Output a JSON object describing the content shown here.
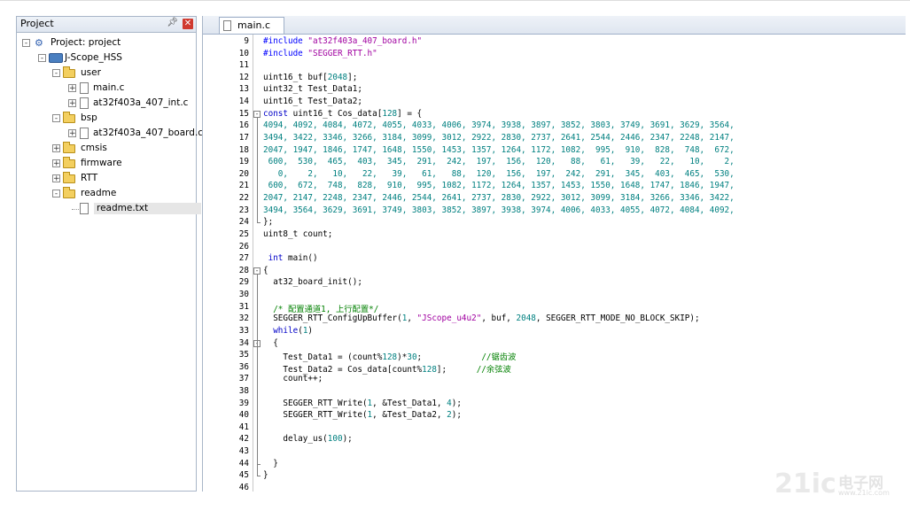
{
  "project_panel": {
    "title": "Project",
    "tree": [
      {
        "label": "Project: project",
        "icon": "project-root-icon"
      },
      {
        "label": "J-Scope_HSS",
        "icon": "target-icon"
      },
      {
        "label": "user",
        "icon": "folder-icon"
      },
      {
        "label": "main.c",
        "icon": "file-icon"
      },
      {
        "label": "at32f403a_407_int.c",
        "icon": "file-icon"
      },
      {
        "label": "bsp",
        "icon": "folder-icon"
      },
      {
        "label": "at32f403a_407_board.c",
        "icon": "file-icon"
      },
      {
        "label": "cmsis",
        "icon": "folder-icon"
      },
      {
        "label": "firmware",
        "icon": "folder-icon"
      },
      {
        "label": "RTT",
        "icon": "folder-icon"
      },
      {
        "label": "readme",
        "icon": "folder-icon"
      },
      {
        "label": "readme.txt",
        "icon": "file-icon"
      }
    ]
  },
  "editor": {
    "tab_label": "main.c",
    "lines": [
      {
        "n": "9",
        "fold": "",
        "parts": [
          [
            "pre",
            "#include "
          ],
          [
            "str",
            "\"at32f403a_407_board.h\""
          ]
        ]
      },
      {
        "n": "10",
        "fold": "",
        "parts": [
          [
            "pre",
            "#include "
          ],
          [
            "str",
            "\"SEGGER_RTT.h\""
          ]
        ]
      },
      {
        "n": "11",
        "fold": "",
        "parts": []
      },
      {
        "n": "12",
        "fold": "",
        "parts": [
          [
            "txt",
            "uint16_t buf["
          ],
          [
            "num",
            "2048"
          ],
          [
            "txt",
            "];"
          ]
        ]
      },
      {
        "n": "13",
        "fold": "",
        "parts": [
          [
            "txt",
            "uint32_t Test_Data1;"
          ]
        ]
      },
      {
        "n": "14",
        "fold": "",
        "parts": [
          [
            "txt",
            "uint16_t Test_Data2;"
          ]
        ]
      },
      {
        "n": "15",
        "fold": "open",
        "parts": [
          [
            "kw",
            "const"
          ],
          [
            "txt",
            " uint16_t Cos_data["
          ],
          [
            "num",
            "128"
          ],
          [
            "txt",
            "] = {"
          ]
        ]
      },
      {
        "n": "16",
        "fold": "",
        "parts": [
          [
            "num",
            "4094, 4092, 4084, 4072, 4055, 4033, 4006, 3974, 3938, 3897, 3852, 3803, 3749, 3691, 3629, 3564,"
          ]
        ]
      },
      {
        "n": "17",
        "fold": "",
        "parts": [
          [
            "num",
            "3494, 3422, 3346, 3266, 3184, 3099, 3012, 2922, 2830, 2737, 2641, 2544, 2446, 2347, 2248, 2147,"
          ]
        ]
      },
      {
        "n": "18",
        "fold": "",
        "parts": [
          [
            "num",
            "2047, 1947, 1846, 1747, 1648, 1550, 1453, 1357, 1264, 1172, 1082,  995,  910,  828,  748,  672,"
          ]
        ]
      },
      {
        "n": "19",
        "fold": "",
        "parts": [
          [
            "num",
            " 600,  530,  465,  403,  345,  291,  242,  197,  156,  120,   88,   61,   39,   22,   10,    2,"
          ]
        ]
      },
      {
        "n": "20",
        "fold": "",
        "parts": [
          [
            "num",
            "   0,    2,   10,   22,   39,   61,   88,  120,  156,  197,  242,  291,  345,  403,  465,  530,"
          ]
        ]
      },
      {
        "n": "21",
        "fold": "",
        "parts": [
          [
            "num",
            " 600,  672,  748,  828,  910,  995, 1082, 1172, 1264, 1357, 1453, 1550, 1648, 1747, 1846, 1947,"
          ]
        ]
      },
      {
        "n": "22",
        "fold": "",
        "parts": [
          [
            "num",
            "2047, 2147, 2248, 2347, 2446, 2544, 2641, 2737, 2830, 2922, 3012, 3099, 3184, 3266, 3346, 3422,"
          ]
        ]
      },
      {
        "n": "23",
        "fold": "",
        "parts": [
          [
            "num",
            "3494, 3564, 3629, 3691, 3749, 3803, 3852, 3897, 3938, 3974, 4006, 4033, 4055, 4072, 4084, 4092,"
          ]
        ]
      },
      {
        "n": "24",
        "fold": "end",
        "parts": [
          [
            "txt",
            "};"
          ]
        ]
      },
      {
        "n": "25",
        "fold": "",
        "parts": [
          [
            "txt",
            "uint8_t count;"
          ]
        ]
      },
      {
        "n": "26",
        "fold": "",
        "parts": []
      },
      {
        "n": "27",
        "fold": "",
        "parts": [
          [
            "txt",
            " "
          ],
          [
            "kw",
            "int"
          ],
          [
            "txt",
            " main()"
          ]
        ]
      },
      {
        "n": "28",
        "fold": "open",
        "parts": [
          [
            "txt",
            "{"
          ]
        ]
      },
      {
        "n": "29",
        "fold": "",
        "parts": [
          [
            "txt",
            "  at32_board_init();"
          ]
        ]
      },
      {
        "n": "30",
        "fold": "",
        "parts": []
      },
      {
        "n": "31",
        "fold": "",
        "parts": [
          [
            "cmt",
            "  /* 配置通道1, 上行配置*/"
          ]
        ]
      },
      {
        "n": "32",
        "fold": "",
        "parts": [
          [
            "txt",
            "  SEGGER_RTT_ConfigUpBuffer("
          ],
          [
            "num",
            "1"
          ],
          [
            "txt",
            ", "
          ],
          [
            "str",
            "\"JScope_u4u2\""
          ],
          [
            "txt",
            ", buf, "
          ],
          [
            "num",
            "2048"
          ],
          [
            "txt",
            ", SEGGER_RTT_MODE_NO_BLOCK_SKIP);"
          ]
        ]
      },
      {
        "n": "33",
        "fold": "",
        "parts": [
          [
            "txt",
            "  "
          ],
          [
            "kw",
            "while"
          ],
          [
            "txt",
            "("
          ],
          [
            "num",
            "1"
          ],
          [
            "txt",
            ")"
          ]
        ]
      },
      {
        "n": "34",
        "fold": "open",
        "parts": [
          [
            "txt",
            "  {"
          ]
        ]
      },
      {
        "n": "35",
        "fold": "",
        "parts": [
          [
            "txt",
            "    Test_Data1 = (count%"
          ],
          [
            "num",
            "128"
          ],
          [
            "txt",
            ")*"
          ],
          [
            "num",
            "30"
          ],
          [
            "txt",
            ";            "
          ],
          [
            "cmt",
            "//锯齿波"
          ]
        ]
      },
      {
        "n": "36",
        "fold": "",
        "parts": [
          [
            "txt",
            "    Test_Data2 = Cos_data[count%"
          ],
          [
            "num",
            "128"
          ],
          [
            "txt",
            "];      "
          ],
          [
            "cmt",
            "//余弦波"
          ]
        ]
      },
      {
        "n": "37",
        "fold": "",
        "parts": [
          [
            "txt",
            "    count++;"
          ]
        ]
      },
      {
        "n": "38",
        "fold": "",
        "parts": []
      },
      {
        "n": "39",
        "fold": "",
        "parts": [
          [
            "txt",
            "    SEGGER_RTT_Write("
          ],
          [
            "num",
            "1"
          ],
          [
            "txt",
            ", &Test_Data1, "
          ],
          [
            "num",
            "4"
          ],
          [
            "txt",
            ");"
          ]
        ]
      },
      {
        "n": "40",
        "fold": "",
        "parts": [
          [
            "txt",
            "    SEGGER_RTT_Write("
          ],
          [
            "num",
            "1"
          ],
          [
            "txt",
            ", &Test_Data2, "
          ],
          [
            "num",
            "2"
          ],
          [
            "txt",
            ");"
          ]
        ]
      },
      {
        "n": "41",
        "fold": "",
        "parts": []
      },
      {
        "n": "42",
        "fold": "",
        "parts": [
          [
            "txt",
            "    delay_us("
          ],
          [
            "num",
            "100"
          ],
          [
            "txt",
            ");"
          ]
        ]
      },
      {
        "n": "43",
        "fold": "",
        "parts": []
      },
      {
        "n": "44",
        "fold": "end",
        "parts": [
          [
            "txt",
            "  }"
          ]
        ]
      },
      {
        "n": "45",
        "fold": "end",
        "parts": [
          [
            "txt",
            "}"
          ]
        ]
      },
      {
        "n": "46",
        "fold": "",
        "parts": []
      }
    ]
  },
  "watermark": {
    "brand": "21ic",
    "sub": "电子网",
    "url": "www.21ic.com"
  }
}
